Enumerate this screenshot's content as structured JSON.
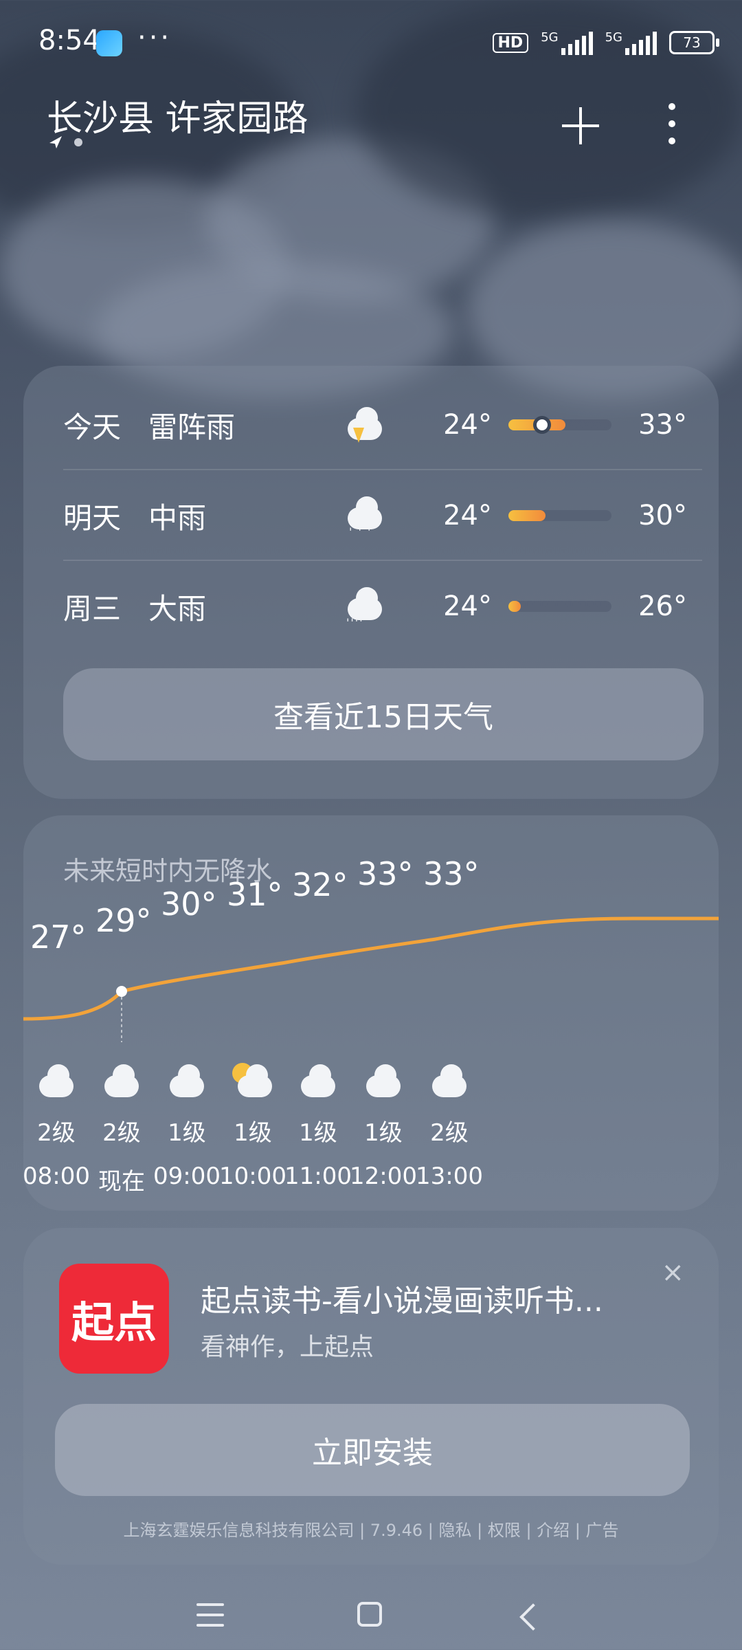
{
  "status_bar": {
    "time": "8:54",
    "more": "···",
    "hd": "HD",
    "net1": "5G",
    "net2": "5G",
    "battery": "73"
  },
  "header": {
    "location": "长沙县 许家园路"
  },
  "forecast": {
    "rows": [
      {
        "day": "今天",
        "condition": "雷阵雨",
        "icon": "thunderstorm-icon",
        "low": "24°",
        "high": "33°",
        "bar_start": 0.0,
        "bar_end": 0.55,
        "current": 0.29
      },
      {
        "day": "明天",
        "condition": "中雨",
        "icon": "rain-icon",
        "low": "24°",
        "high": "30°",
        "bar_start": 0.0,
        "bar_end": 0.36
      },
      {
        "day": "周三",
        "condition": "大雨",
        "icon": "heavy-rain-icon",
        "low": "24°",
        "high": "26°",
        "bar_start": 0.0,
        "bar_end": 0.12
      }
    ],
    "button_label": "查看近15日天气"
  },
  "hourly": {
    "title": "未来短时内无降水",
    "hours": [
      {
        "time": "08:00",
        "temp": "27°",
        "wind": "2级",
        "icon": "cloudy-icon"
      },
      {
        "time": "现在",
        "temp": "29°",
        "wind": "2级",
        "icon": "cloudy-icon"
      },
      {
        "time": "09:00",
        "temp": "30°",
        "wind": "1级",
        "icon": "cloudy-icon"
      },
      {
        "time": "10:00",
        "temp": "31°",
        "wind": "1级",
        "icon": "partly-cloudy-icon"
      },
      {
        "time": "11:00",
        "temp": "32°",
        "wind": "1级",
        "icon": "cloudy-icon"
      },
      {
        "time": "12:00",
        "temp": "33°",
        "wind": "1级",
        "icon": "cloudy-icon"
      },
      {
        "time": "13:00",
        "temp": "33°",
        "wind": "2级",
        "icon": "cloudy-icon"
      }
    ]
  },
  "ad": {
    "icon_text": "起点",
    "title": "起点读书-看小说漫画读听书...",
    "subtitle": "看神作，上起点",
    "close": "×",
    "install_label": "立即安装",
    "footer": "上海玄霆娱乐信息科技有限公司 | 7.9.46 | 隐私 | 权限 | 介绍 | 广告"
  },
  "colors": {
    "accent_orange": "#f28b3c",
    "accent_yellow": "#f6c040",
    "ad_red": "#ee2a38"
  }
}
